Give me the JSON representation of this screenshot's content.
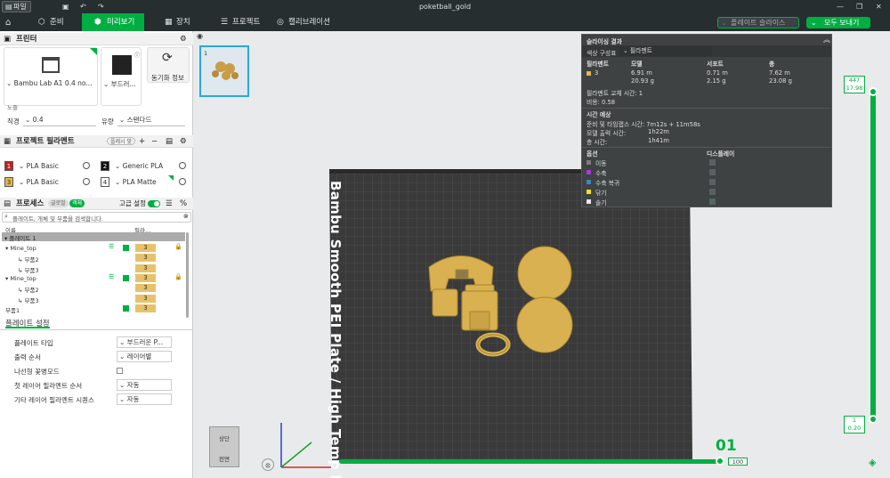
{
  "window": {
    "file_menu": "파일",
    "title": "poketball_gold"
  },
  "tabs": [
    {
      "label": "준비",
      "icon": "home-icon"
    },
    {
      "label": "미리보기",
      "icon": "preview-icon"
    },
    {
      "label": "장치",
      "icon": "device-icon"
    },
    {
      "label": "프로젝트",
      "icon": "project-icon"
    },
    {
      "label": "캘리브레이션",
      "icon": "calibration-icon"
    }
  ],
  "actions": {
    "slice_plate": "플레이트 슬라이스",
    "send_all": "모두 보내기"
  },
  "printer": {
    "section_title": "프린터",
    "printer_name": "Bambu Lab A1 0.4 no...",
    "bed_type": "부드러...",
    "sync_label": "동기화 정보",
    "nozzle_label": "노즐",
    "diameter_label": "직경",
    "diameter_value": "0.4",
    "flow_label": "유량",
    "flow_value": "스탠다드"
  },
  "filaments": {
    "section_title": "프로젝트 필라멘트",
    "clear_label": "플레시 맞",
    "items": [
      {
        "num": "1",
        "name": "PLA Basic",
        "color": "#c0221b"
      },
      {
        "num": "2",
        "name": "Generic PLA",
        "color": "#111111"
      },
      {
        "num": "3",
        "name": "PLA Basic",
        "color": "#e5b64a"
      },
      {
        "num": "4",
        "name": "PLA Matte",
        "color": "#ffffff"
      }
    ]
  },
  "process": {
    "section_title": "프로세스",
    "global_label": "글로벌",
    "object_label": "객체",
    "advanced_label": "고급 설정",
    "search_placeholder": "플레이트, 개체 및 부품을 검색합니다.",
    "col_name": "이름",
    "col_fil": "필라...",
    "plate_label": "플레이트 1",
    "tree": [
      {
        "label": "Mine_top",
        "level": 1,
        "filament": "3",
        "checked": true
      },
      {
        "label": "부품2",
        "level": 2,
        "filament": "3",
        "checked": false
      },
      {
        "label": "부품3",
        "level": 2,
        "filament": "3",
        "checked": false
      },
      {
        "label": "Mine_top",
        "level": 1,
        "filament": "3",
        "checked": true
      },
      {
        "label": "부품2",
        "level": 2,
        "filament": "3",
        "checked": false
      },
      {
        "label": "부품3",
        "level": 2,
        "filament": "3",
        "checked": false
      },
      {
        "label": "부품1",
        "level": 1,
        "filament": "3",
        "checked": true
      }
    ]
  },
  "plate_settings": {
    "tab_label": "플레이트 설정",
    "rows": [
      {
        "label": "플레이트 타입",
        "value": "부드러운 P..."
      },
      {
        "label": "출력 순서",
        "value": "레이어별"
      },
      {
        "label": "나선형 꽃병모드",
        "value": ""
      },
      {
        "label": "첫 레이어 필라멘트 순서",
        "value": "자동"
      },
      {
        "label": "기타 레이어 필라멘트 시퀀스",
        "value": "자동"
      }
    ]
  },
  "slicing_result": {
    "title": "슬라이싱 결과",
    "color_scheme_label": "색상 구성표",
    "color_scheme_value": "필라멘트",
    "headers": [
      "필라멘트",
      "모델",
      "서포트",
      "총"
    ],
    "row": {
      "id": "3",
      "model_len": "6.91 m",
      "model_g": "20.93 g",
      "support_len": "0.71 m",
      "support_g": "2.15 g",
      "total_len": "7.62 m",
      "total_g": "23.08 g"
    },
    "filament_changes": "필라멘트 교체 시간:  1",
    "cost": "비용:  0.58",
    "time_title": "시간 예상",
    "prep_time": "준비 및 타임랩스 시간:  7m12s + 11m58s",
    "model_time_label": "모델 출력 시간:",
    "model_time": "1h22m",
    "total_time_label": "총 시간:",
    "total_time": "1h41m",
    "options_label": "옵션",
    "display_label": "디스플레이",
    "legend": [
      {
        "label": "이동",
        "color": "#7d7d7d",
        "shown": false
      },
      {
        "label": "수축",
        "color": "#a43bd4",
        "shown": false
      },
      {
        "label": "수축 복귀",
        "color": "#3a84c9",
        "shown": false
      },
      {
        "label": "닦기",
        "color": "#f2e21a",
        "shown": false
      },
      {
        "label": "솔기",
        "color": "#e8e8e8",
        "shown": true
      }
    ]
  },
  "viewport": {
    "bed_label": "Bambu Smooth PEI Plate / High Temp Plate",
    "plate_number": "01",
    "layer_top": "447",
    "layer_top_height": "17.98",
    "layer_bottom": "1",
    "layer_bottom_height": "0.20",
    "progress_value": "100",
    "view_cube_top": "상단",
    "view_cube_front": "전면",
    "thumbnail_index": "1"
  },
  "colors": {
    "accent": "#00ae42",
    "model": "#d9b150",
    "bed": "#3a3a3a",
    "dark": "#262e30"
  }
}
